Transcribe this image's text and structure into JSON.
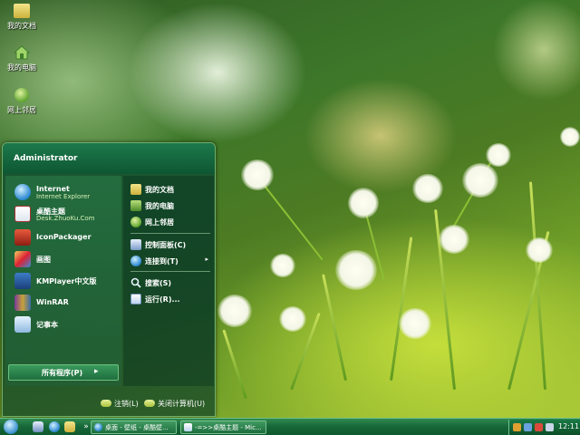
{
  "desktop": {
    "icons": [
      {
        "label": "我的文档",
        "icon": "folder-icon"
      },
      {
        "label": "我的电脑",
        "icon": "home-icon"
      },
      {
        "label": "网上邻居",
        "icon": "globe-icon"
      }
    ]
  },
  "start_menu": {
    "user": "Administrator",
    "pinned": [
      {
        "title": "Internet",
        "subtitle": "Internet Explorer",
        "icon": "ie-icon"
      },
      {
        "title": "桌酷主题",
        "subtitle": "Desk.ZhuoKu.Com",
        "icon": "zhuoku-icon"
      }
    ],
    "recent": [
      {
        "title": "IconPackager",
        "icon": "iconpackager-icon"
      },
      {
        "title": "画图",
        "icon": "paint-icon"
      },
      {
        "title": "KMPlayer中文版",
        "icon": "kmplayer-icon"
      },
      {
        "title": "WinRAR",
        "icon": "winrar-icon"
      },
      {
        "title": "记事本",
        "icon": "notepad-icon"
      }
    ],
    "all_programs": "所有程序(P)",
    "right": {
      "group1": [
        {
          "label": "我的文档",
          "icon": "folder-icon"
        },
        {
          "label": "我的电脑",
          "icon": "computer-icon"
        },
        {
          "label": "网上邻居",
          "icon": "globe-icon"
        }
      ],
      "group2": [
        {
          "label": "控制面板(C)",
          "icon": "control-panel-icon"
        },
        {
          "label": "连接到(T)",
          "icon": "connect-icon",
          "arrow": "▸"
        }
      ],
      "group3": [
        {
          "label": "搜索(S)",
          "icon": "search-icon"
        },
        {
          "label": "运行(R)...",
          "icon": "run-icon"
        }
      ]
    },
    "footer": {
      "logoff": "注销(L)",
      "shutdown": "关闭计算机(U)"
    }
  },
  "taskbar": {
    "tasks": [
      {
        "label": "桌面 - 壁纸 - 桌酷壁...",
        "icon": "ie-icon"
      },
      {
        "label": "-=>>桌酷主题 - Mic...",
        "icon": "doc-icon"
      }
    ],
    "clock": "12:11"
  },
  "colors": {
    "accent": "#1f7a45",
    "menu_border": "#6fae6a"
  }
}
